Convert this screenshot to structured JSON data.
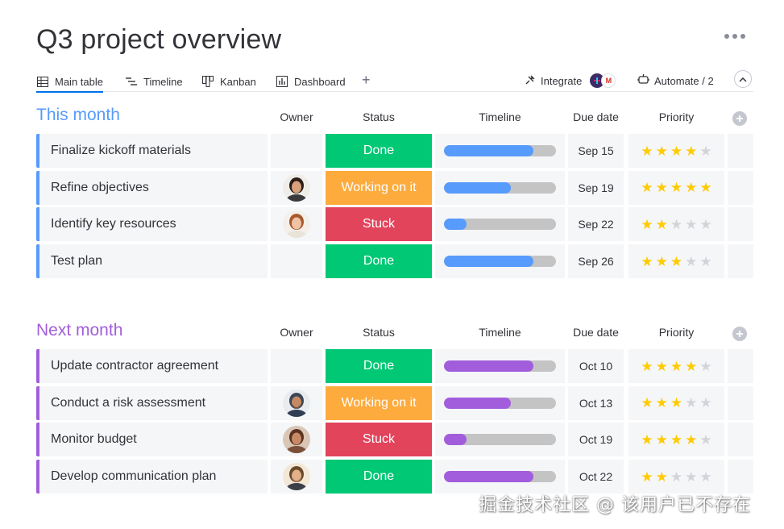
{
  "page": {
    "title": "Q3 project overview"
  },
  "tabs": [
    {
      "label": "Main table",
      "icon": "table-icon",
      "active": true
    },
    {
      "label": "Timeline",
      "icon": "timeline-icon"
    },
    {
      "label": "Kanban",
      "icon": "kanban-icon"
    },
    {
      "label": "Dashboard",
      "icon": "dashboard-icon"
    }
  ],
  "toolbar": {
    "integrate_label": "Integrate",
    "automate_label": "Automate / 2"
  },
  "columns": {
    "owner": "Owner",
    "status": "Status",
    "timeline": "Timeline",
    "due": "Due date",
    "priority": "Priority"
  },
  "colors": {
    "this_month": "#579bfc",
    "next_month": "#a25ddc",
    "done": "#00c875",
    "working": "#fdab3d",
    "stuck": "#e2445c"
  },
  "groups": [
    {
      "title": "This month",
      "color": "#579bfc",
      "rows": [
        {
          "name": "Finalize kickoff materials",
          "owner": "",
          "status": "Done",
          "status_color": "#00c875",
          "timeline_progress": 0.8,
          "due": "Sep 15",
          "priority": 4
        },
        {
          "name": "Refine objectives",
          "owner": "woman-dark-hair-avatar",
          "status": "Working on it",
          "status_color": "#fdab3d",
          "timeline_progress": 0.6,
          "due": "Sep 19",
          "priority": 5
        },
        {
          "name": "Identify key resources",
          "owner": "woman-red-hair-avatar",
          "status": "Stuck",
          "status_color": "#e2445c",
          "timeline_progress": 0.2,
          "due": "Sep 22",
          "priority": 2
        },
        {
          "name": "Test plan",
          "owner": "",
          "status": "Done",
          "status_color": "#00c875",
          "timeline_progress": 0.8,
          "due": "Sep 26",
          "priority": 3
        }
      ]
    },
    {
      "title": "Next month",
      "color": "#a25ddc",
      "rows": [
        {
          "name": "Update contractor agreement",
          "owner": "",
          "status": "Done",
          "status_color": "#00c875",
          "timeline_progress": 0.8,
          "due": "Oct 10",
          "priority": 4
        },
        {
          "name": "Conduct a risk assessment",
          "owner": "man-turban-avatar",
          "status": "Working on it",
          "status_color": "#fdab3d",
          "timeline_progress": 0.6,
          "due": "Oct 13",
          "priority": 3
        },
        {
          "name": "Monitor budget",
          "owner": "woman-curly-hair-avatar",
          "status": "Stuck",
          "status_color": "#e2445c",
          "timeline_progress": 0.2,
          "due": "Oct 19",
          "priority": 4
        },
        {
          "name": "Develop communication plan",
          "owner": "man-beard-avatar",
          "status": "Done",
          "status_color": "#00c875",
          "timeline_progress": 0.8,
          "due": "Oct 22",
          "priority": 2
        }
      ]
    }
  ],
  "watermark": "掘金技术社区 @ 该用户已不存在"
}
